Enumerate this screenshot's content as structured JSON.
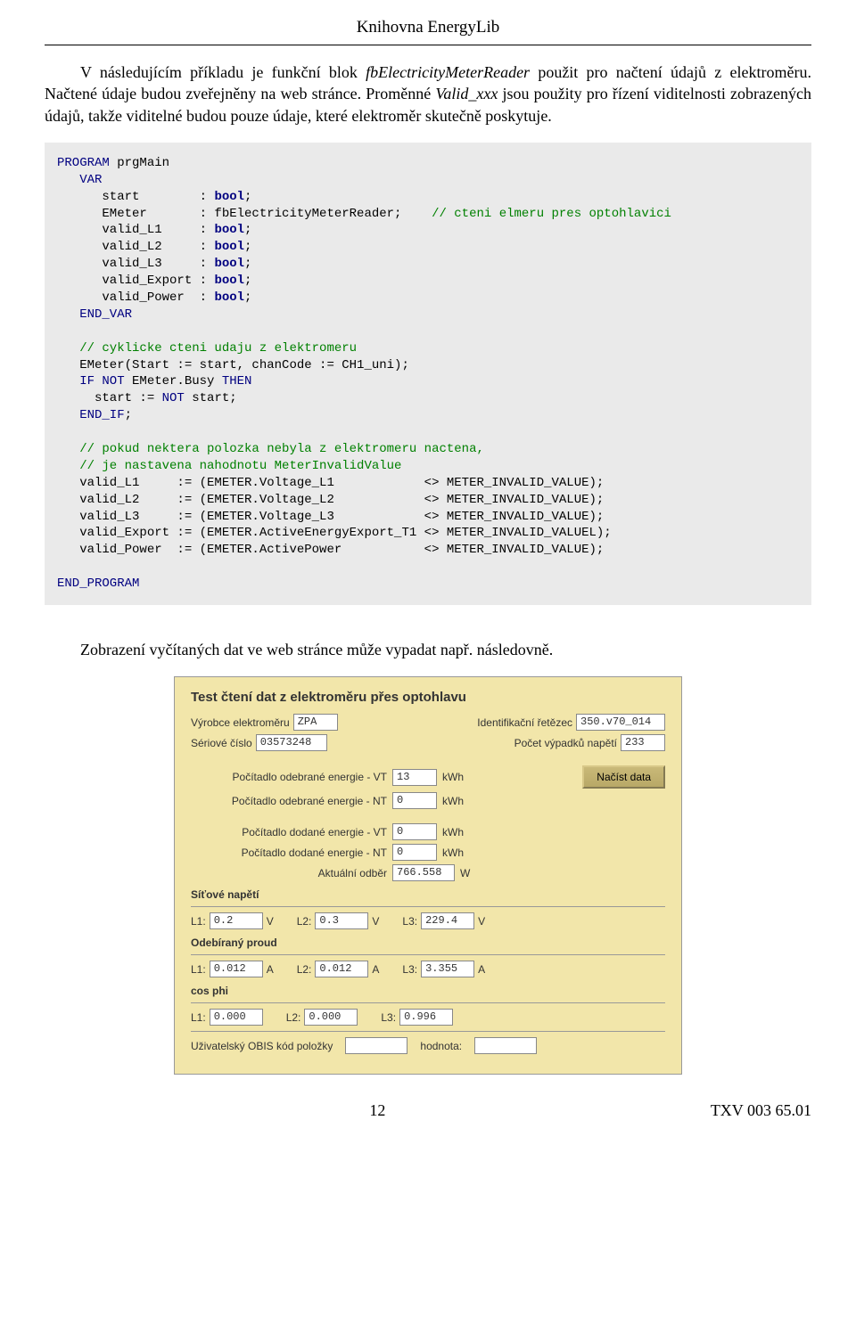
{
  "header": "Knihovna EnergyLib",
  "para1_pre": "V následujícím příkladu je funkční blok ",
  "para1_it1": "fbElectricityMeterReader",
  "para1_mid": " použit pro načtení údajů z elektroměru. Načtené údaje budou zveřejněny na web stránce. Proměnné ",
  "para1_it2": "Valid_xxx",
  "para1_post": " jsou použity pro řízení viditelnosti zobrazených údajů, takže viditelné budou pouze údaje, které elektroměr skutečně poskytuje.",
  "code": {
    "l1a": "PROGRAM",
    "l1b": " prgMain",
    "l2": "   VAR",
    "l3a": "      start        : ",
    "l3b": "bool",
    "l3c": ";",
    "l4a": "      EMeter       : fbElectricityMeterReader;    ",
    "l4b": "// cteni elmeru pres optohlavici",
    "l5a": "      valid_L1     : ",
    "l5b": "bool",
    "l5c": ";",
    "l6a": "      valid_L2     : ",
    "l6b": "bool",
    "l6c": ";",
    "l7a": "      valid_L3     : ",
    "l7b": "bool",
    "l7c": ";",
    "l8a": "      valid_Export : ",
    "l8b": "bool",
    "l8c": ";",
    "l9a": "      valid_Power  : ",
    "l9b": "bool",
    "l9c": ";",
    "l10": "   END_VAR",
    "l12": "   // cyklicke cteni udaju z elektromeru",
    "l13": "   EMeter(Start := start, chanCode := CH1_uni);",
    "l14a": "   IF NOT",
    "l14b": " EMeter.Busy ",
    "l14c": "THEN",
    "l15a": "     start := ",
    "l15b": "NOT",
    "l15c": " start;",
    "l16": "   END_IF",
    "l16b": ";",
    "l18": "   // pokud nektera polozka nebyla z elektromeru nactena,",
    "l19": "   // je nastavena nahodnotu MeterInvalidValue",
    "l20": "   valid_L1     := (EMETER.Voltage_L1            <> METER_INVALID_VALUE);",
    "l21": "   valid_L2     := (EMETER.Voltage_L2            <> METER_INVALID_VALUE);",
    "l22": "   valid_L3     := (EMETER.Voltage_L3            <> METER_INVALID_VALUE);",
    "l23": "   valid_Export := (EMETER.ActiveEnergyExport_T1 <> METER_INVALID_VALUEL);",
    "l24": "   valid_Power  := (EMETER.ActivePower           <> METER_INVALID_VALUE);",
    "l26": "END_PROGRAM"
  },
  "para2": "Zobrazení vyčítaných dat ve web stránce může vypadat např. následovně.",
  "wp": {
    "title": "Test čtení dat z elektroměru přes optohlavu",
    "lbl_manu": "Výrobce elektroměru",
    "val_manu": "ZPA",
    "lbl_id": "Identifikační řetězec",
    "val_id": "350.v70_014",
    "lbl_serial": "Sériové číslo",
    "val_serial": "03573248",
    "lbl_outage": "Počet výpadků napětí",
    "val_outage": "233",
    "lbl_cons_vt": "Počítadlo odebrané energie - VT",
    "val_cons_vt": "13",
    "lbl_cons_nt": "Počítadlo odebrané energie - NT",
    "val_cons_nt": "0",
    "lbl_sup_vt": "Počítadlo dodané energie - VT",
    "val_sup_vt": "0",
    "lbl_sup_nt": "Počítadlo dodané energie - NT",
    "val_sup_nt": "0",
    "lbl_actual": "Aktuální odběr",
    "val_actual": "766.558",
    "unit_kwh": "kWh",
    "unit_w": "W",
    "btn_load": "Načíst data",
    "sec_voltage": "Síťové napětí",
    "l1": "L1:",
    "l2": "L2:",
    "l3": "L3:",
    "v_l1": "0.2",
    "v_l2": "0.3",
    "v_l3": "229.4",
    "unit_v": "V",
    "sec_current": "Odebíraný proud",
    "i_l1": "0.012",
    "i_l2": "0.012",
    "i_l3": "3.355",
    "unit_a": "A",
    "sec_cos": "cos phi",
    "c_l1": "0.000",
    "c_l2": "0.000",
    "c_l3": "0.996",
    "lbl_obis": "Uživatelský OBIS kód položky",
    "lbl_hodnota": "hodnota:",
    "val_obis": "",
    "val_hodnota": ""
  },
  "footer_page": "12",
  "footer_doc": "TXV 003 65.01"
}
